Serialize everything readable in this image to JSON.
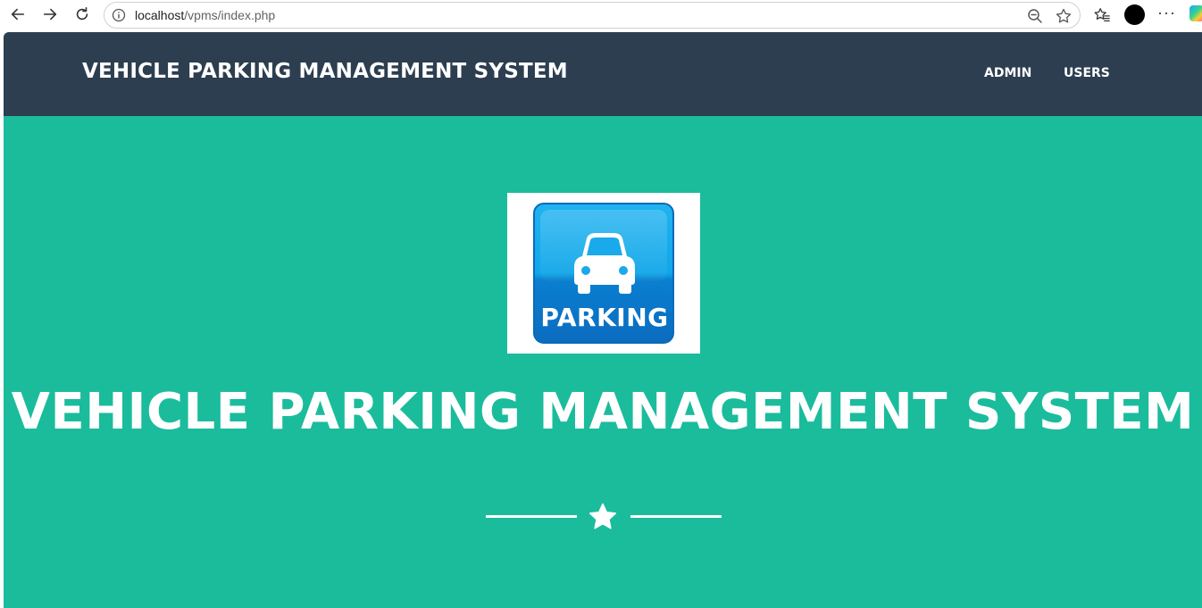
{
  "browser": {
    "url_host": "localhost",
    "url_path": "/vpms/index.php"
  },
  "navbar": {
    "brand": "VEHICLE PARKING MANAGEMENT SYSTEM",
    "links": [
      "ADMIN",
      "USERS"
    ]
  },
  "hero": {
    "logo_text": "PARKING",
    "title": "VEHICLE PARKING MANAGEMENT SYSTEM"
  },
  "colors": {
    "navbar_bg": "#2c3e50",
    "hero_bg": "#1abc9c",
    "text": "#ffffff",
    "logo_blue": "#11a6e8"
  },
  "icons": [
    "back-arrow-icon",
    "forward-arrow-icon",
    "reload-icon",
    "info-icon",
    "zoom-out-icon",
    "star-bookmark-icon",
    "favorites-icon",
    "more-icon",
    "car-icon",
    "star-icon"
  ]
}
